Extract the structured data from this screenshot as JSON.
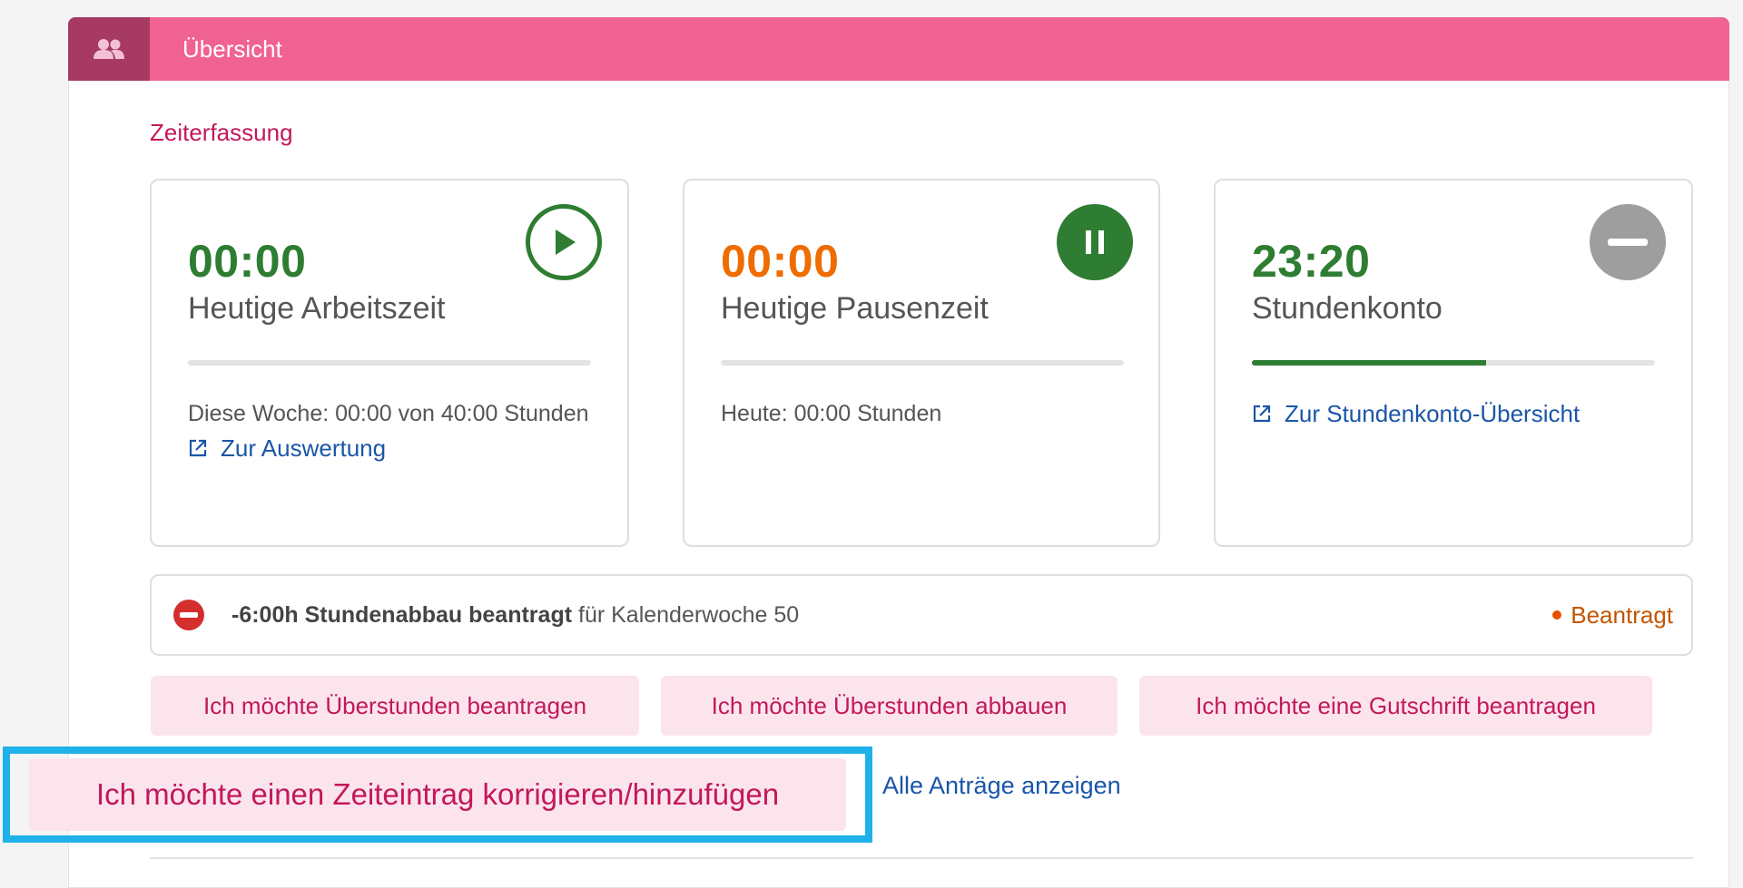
{
  "header": {
    "title": "Übersicht",
    "icon": "people-icon"
  },
  "section": {
    "title": "Zeiterfassung"
  },
  "cards": {
    "work": {
      "time": "00:00",
      "label": "Heutige Arbeitszeit",
      "info": "Diese Woche: 00:00 von 40:00 Stunden",
      "link": "Zur Auswertung",
      "progress": 0,
      "color": "#2e7d32",
      "icon": "play-icon"
    },
    "pause": {
      "time": "00:00",
      "label": "Heutige Pausenzeit",
      "info": "Heute: 00:00 Stunden",
      "progress": 0,
      "color": "#ef6c00",
      "icon": "pause-icon"
    },
    "account": {
      "time": "23:20",
      "label": "Stundenkonto",
      "link": "Zur Stundenkonto-Übersicht",
      "progress": 0.58,
      "color": "#2e7d32",
      "icon": "minus-icon"
    }
  },
  "request": {
    "bold": "-6:00h Stundenabbau beantragt",
    "rest": "für Kalenderwoche 50",
    "status": "Beantragt"
  },
  "buttons": {
    "overtime_request": "Ich möchte Überstunden beantragen",
    "overtime_reduce": "Ich möchte Überstunden abbauen",
    "credit_request": "Ich möchte eine Gutschrift beantragen",
    "correct_entry": "Ich möchte einen Zeiteintrag korrigieren/hinzufügen"
  },
  "links": {
    "all_requests": "Alle Anträge anzeigen"
  },
  "colors": {
    "header": "#f06292",
    "header_icon_bg": "#a63a62",
    "accent": "#c2185b",
    "link": "#1a56a8",
    "button_bg": "#fce4ec",
    "highlight": "#1fb1e8",
    "status": "#c45500"
  }
}
